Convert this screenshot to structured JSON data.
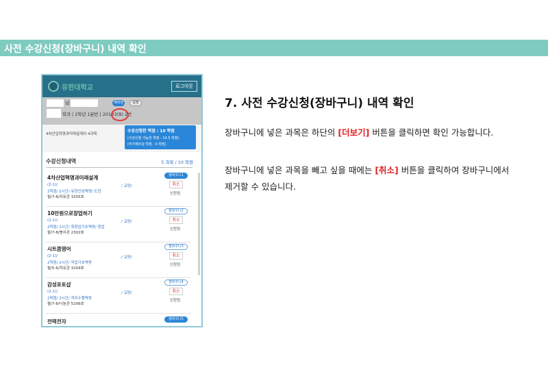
{
  "header": {
    "title": "사전 수강신청(장바구니) 내역 확인"
  },
  "phone": {
    "logo_text": "유한대학교",
    "logout_label": "로그아웃",
    "user": {
      "name_suffix": "님",
      "info_label": "재학생",
      "settings_label": "설정",
      "dept_line": "학과 | 2학년 1분반 | 20183(B) 2반"
    },
    "summary": {
      "label": "4차산업혁명과미래설계외 4과목",
      "credits_line": "수강신청한 학점 : 10 학점",
      "avail_line": "(수강신청 가능한 학점 : 14.5 학점)",
      "retake_line": "(추가재수강 학점 : 0 학점)"
    },
    "list": {
      "heading": "수강신청내역",
      "count": "5 과목 / 10 학점",
      "courses": [
        {
          "name": "4차산업혁명과미래설계",
          "code": "(2-1)/",
          "type": "/ 교양/",
          "detail": "2학점/ 2시간/ 유한인성역량/ 도전",
          "schedule": "월/7-8/자유관 3205호",
          "badge": "장바구니1",
          "cancel": "취소",
          "status": "신청됨"
        },
        {
          "name": "10만원으로창업하기",
          "code": "(2-1)/",
          "type": "/ 교양/",
          "detail": "2학점/ 2시간/ 취창업기초역량/ 창업",
          "schedule": "월/7-8/봉사관 2302호",
          "badge": "장바구니2",
          "cancel": "취소",
          "status": "신청됨"
        },
        {
          "name": "시트콤영어",
          "code": "(2-1)/",
          "type": "/ 교양/",
          "detail": "2학점/ 2시간/ 직업기초역량",
          "schedule": "월/5-6/자유관 3204호",
          "badge": "장바구니3",
          "cancel": "취소",
          "status": "신청됨"
        },
        {
          "name": "감성포토샵",
          "code": "(2-1)/",
          "type": "/ 교양/",
          "detail": "2학점/ 2시간/ 직무수행역량",
          "schedule": "월/7-8/나눔관 5206호",
          "badge": "장바구니4",
          "cancel": "취소",
          "status": "신청됨"
        },
        {
          "name": "전력전자",
          "badge": "장바구니5"
        }
      ]
    }
  },
  "content": {
    "step_title": "7. 사전 수강신청(장바구니) 내역 확인",
    "p1_before": "장바구니에 넣은 과목은 하단의 ",
    "p1_key": "[더보기]",
    "p1_after": " 버튼을 클릭하면 확인 가능합니다.",
    "p2_before": "장바구니에 넣은 과목을 빼고 싶을 때에는 ",
    "p2_key": "[취소]",
    "p2_after": " 버튼을 클릭하여 장바구니에서 제거할 수 있습니다."
  }
}
